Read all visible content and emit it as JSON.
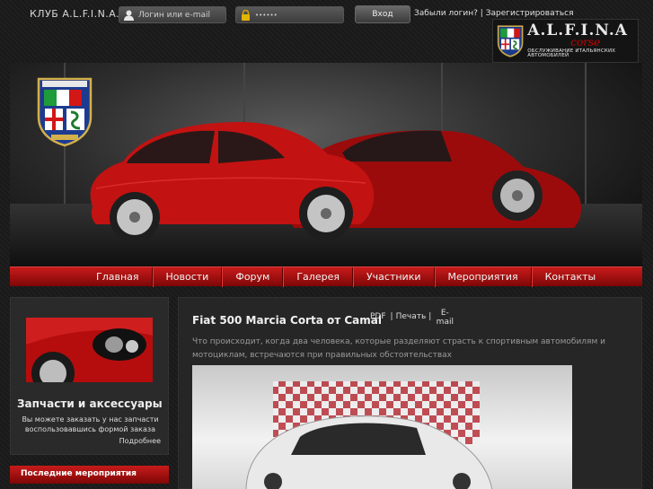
{
  "header": {
    "club_title": "КЛУБ A.L.F.I.N.A.",
    "login_placeholder": "Логин или e-mail",
    "password_value": "••••••",
    "login_button": "Вход",
    "forgot_link": "Забыли логин?",
    "separator": "|",
    "register_link": "Зарегистрироваться"
  },
  "brand": {
    "name_a": "A.L.F.I.N.A",
    "corse": "corse",
    "subtitle": "ОБСЛУЖИВАНИЕ ИТАЛЬЯНСКИХ АВТОМОБИЛЕЙ"
  },
  "nav": {
    "items": [
      {
        "label": "Главная"
      },
      {
        "label": "Новости"
      },
      {
        "label": "Форум"
      },
      {
        "label": "Галерея"
      },
      {
        "label": "Участники"
      },
      {
        "label": "Мероприятия"
      },
      {
        "label": "Контакты"
      }
    ]
  },
  "sidebar": {
    "title": "Запчасти и аксессуары",
    "text": "Вы можете заказать у нас запчасти воспользовавшись формой заказа",
    "more": "Подробнее",
    "events_title": "Последние мероприятия"
  },
  "article": {
    "title": "Fiat 500 Marcia Corta от Camal",
    "pdf": "PDF",
    "print": "Печать",
    "sep": "|",
    "email": "E-mail",
    "description": "Что происходит, когда два человека, которые разделяют страсть к спортивным автомобилям и мотоциклам, встречаются при правильных обстоятельствах"
  },
  "colors": {
    "accent_red": "#c81a1a",
    "background": "#1b1b1b"
  }
}
